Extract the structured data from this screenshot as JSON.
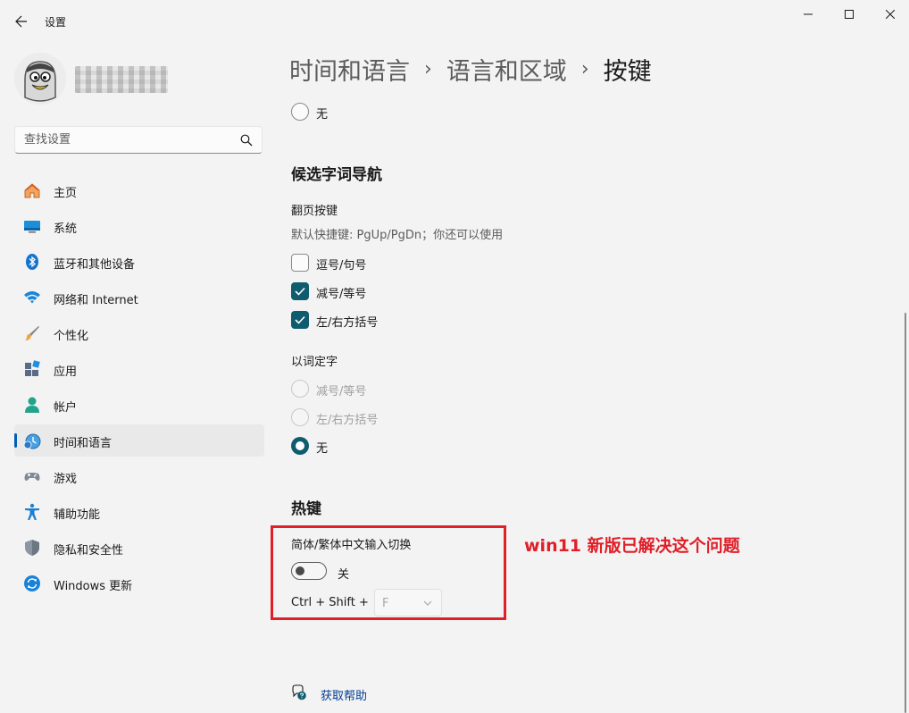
{
  "app": {
    "title": "设置"
  },
  "user": {
    "avatar_icon": "penguin-avatar",
    "name_blurred": true
  },
  "search": {
    "placeholder": "查找设置"
  },
  "sidebar": {
    "items": [
      {
        "label": "主页",
        "icon": "home-icon"
      },
      {
        "label": "系统",
        "icon": "system-icon"
      },
      {
        "label": "蓝牙和其他设备",
        "icon": "bluetooth-icon"
      },
      {
        "label": "网络和 Internet",
        "icon": "wifi-icon"
      },
      {
        "label": "个性化",
        "icon": "brush-icon"
      },
      {
        "label": "应用",
        "icon": "apps-icon"
      },
      {
        "label": "帐户",
        "icon": "account-icon"
      },
      {
        "label": "时间和语言",
        "icon": "time-language-icon",
        "active": true
      },
      {
        "label": "游戏",
        "icon": "gamepad-icon"
      },
      {
        "label": "辅助功能",
        "icon": "accessibility-icon"
      },
      {
        "label": "隐私和安全性",
        "icon": "shield-icon"
      },
      {
        "label": "Windows 更新",
        "icon": "update-icon"
      }
    ]
  },
  "breadcrumb": {
    "level1": "时间和语言",
    "level2": "语言和区域",
    "current": "按键"
  },
  "top_option": {
    "label": "无"
  },
  "candidate_nav": {
    "title": "候选字词导航",
    "page_keys": {
      "label": "翻页按键",
      "desc": "默认快捷键: PgUp/PgDn；你还可以使用",
      "options": [
        {
          "label": "逗号/句号",
          "checked": false
        },
        {
          "label": "减号/等号",
          "checked": true
        },
        {
          "label": "左/右方括号",
          "checked": true
        }
      ]
    },
    "word_select": {
      "label": "以词定字",
      "options": [
        {
          "label": "减号/等号",
          "state": "disabled"
        },
        {
          "label": "左/右方括号",
          "state": "disabled"
        },
        {
          "label": "无",
          "state": "checked"
        }
      ]
    }
  },
  "hotkeys": {
    "title": "热键",
    "switch_label": "简体/繁体中文输入切换",
    "toggle_state": "关",
    "shortcut_prefix": "Ctrl + Shift +",
    "shortcut_key": "F"
  },
  "annotation": {
    "text": "win11 新版已解决这个问题",
    "color": "#e01f28"
  },
  "help": {
    "label": "获取帮助"
  },
  "colors": {
    "accent": "#0f5c6e",
    "link": "#003e92",
    "nav_indicator": "#005fb8"
  }
}
